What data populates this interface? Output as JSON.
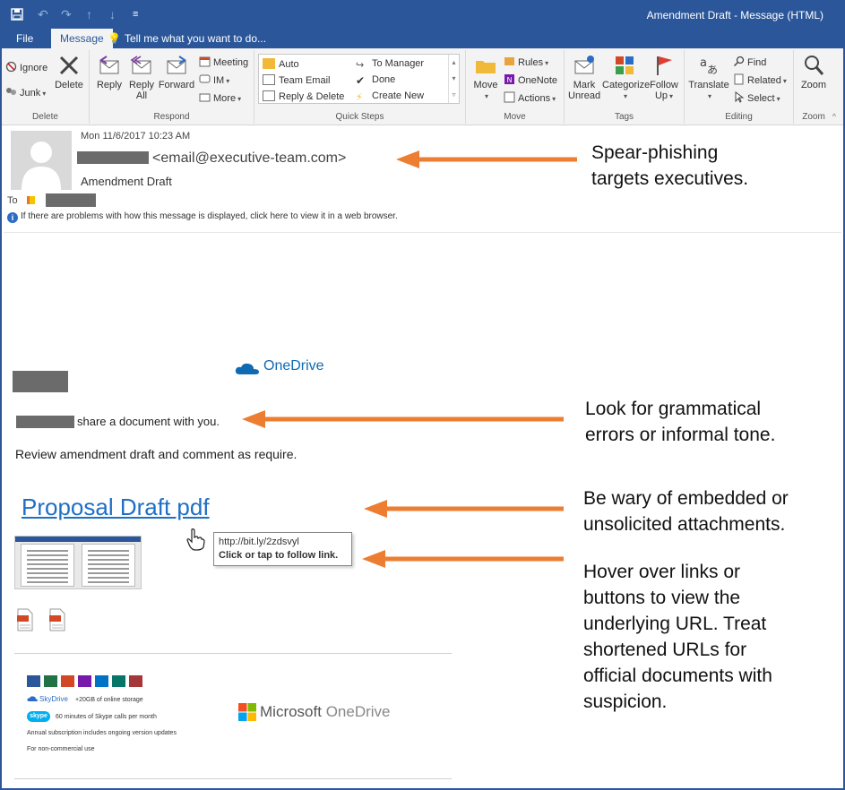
{
  "window": {
    "title": "Amendment Draft - Message (HTML)"
  },
  "tabs": [
    {
      "label": "File"
    },
    {
      "label": "Message"
    }
  ],
  "tell_me": "Tell me what you want to do...",
  "ribbon": {
    "delete_group": {
      "label": "Delete",
      "ignore": "Ignore",
      "junk": "Junk",
      "delete": "Delete"
    },
    "respond_group": {
      "label": "Respond",
      "reply": "Reply",
      "reply_all_line1": "Reply",
      "reply_all_line2": "All",
      "forward": "Forward",
      "meeting": "Meeting",
      "im": "IM",
      "more": "More"
    },
    "quick_steps_group": {
      "label": "Quick Steps",
      "items": [
        "Auto",
        "Team Email",
        "Reply & Delete",
        "To Manager",
        "Done",
        "Create New"
      ]
    },
    "move_group": {
      "label": "Move",
      "move": "Move",
      "rules": "Rules",
      "onenote": "OneNote",
      "actions": "Actions"
    },
    "tags_group": {
      "label": "Tags",
      "mark_unread_line1": "Mark",
      "mark_unread_line2": "Unread",
      "categorize": "Categorize",
      "follow_up_line1": "Follow",
      "follow_up_line2": "Up"
    },
    "editing_group": {
      "label": "Editing",
      "translate": "Translate",
      "find": "Find",
      "related": "Related",
      "select": "Select"
    },
    "zoom_group": {
      "label": "Zoom",
      "zoom": "Zoom"
    }
  },
  "message_header": {
    "date": "Mon 11/6/2017 10:23 AM",
    "from_email": "<email@executive-team.com>",
    "subject": "Amendment Draft",
    "to_label": "To",
    "info_bar": "If there are problems with how this message is displayed, click here to view it in a web browser."
  },
  "message_body": {
    "brand": "OneDrive",
    "shared_text": "share a document with you.",
    "review_text": "Review amendment draft and comment as require.",
    "link_text": "Proposal Draft pdf",
    "tooltip_url": "http://bit.ly/2zdsvyl",
    "tooltip_hint": "Click or tap to follow link.",
    "footer": {
      "skydrive": "SkyDrive",
      "storage": "+20GB of online storage",
      "skype": "skype",
      "skype_text": "60 minutes of Skype calls per month",
      "updates": "Annual subscription includes ongoing version updates",
      "noncommercial": "For non-commercial use",
      "ms_word": "Microsoft",
      "od_word": "OneDrive"
    }
  },
  "annotations": [
    {
      "line1": "Spear-phishing",
      "line2": "targets executives."
    },
    {
      "line1": "Look for grammatical",
      "line2": "errors or informal tone."
    },
    {
      "line1": "Be wary of embedded or",
      "line2": "unsolicited attachments."
    },
    {
      "line1": "Hover over links or",
      "line2": "buttons to view the",
      "line3": "underlying URL. Treat",
      "line4": "shortened URLs for",
      "line5": "official documents with",
      "line6": "suspicion."
    }
  ],
  "colors": {
    "titlebar": "#2b579a",
    "link": "#1f6fc5",
    "arrow": "#ed7d31",
    "redaction": "#6b6b6b"
  }
}
